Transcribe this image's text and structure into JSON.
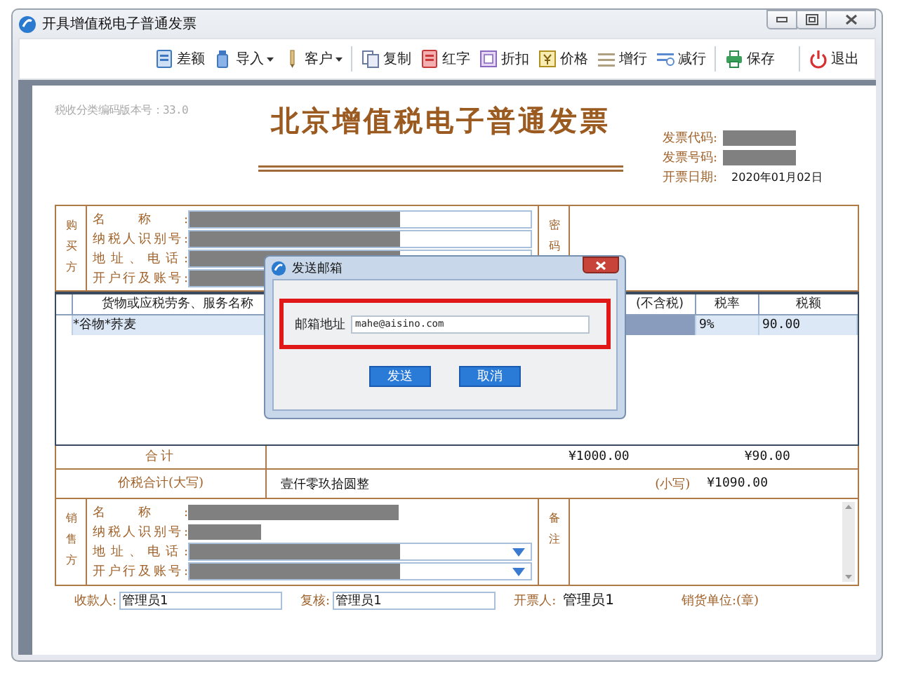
{
  "window": {
    "title": "开具增值税电子普通发票"
  },
  "toolbar": [
    [
      {
        "label": "差额",
        "has_menu": false
      },
      {
        "label": "导入",
        "has_menu": true
      },
      {
        "label": "客户",
        "has_menu": true
      }
    ],
    [
      {
        "label": "复制",
        "has_menu": false
      },
      {
        "label": "红字",
        "has_menu": false
      },
      {
        "label": "折扣",
        "has_menu": false
      },
      {
        "label": "价格",
        "has_menu": false
      },
      {
        "label": "增行",
        "has_menu": false
      },
      {
        "label": "减行",
        "has_menu": false
      }
    ],
    [
      {
        "label": "保存",
        "has_menu": false
      }
    ],
    [
      {
        "label": "退出",
        "has_menu": false
      }
    ]
  ],
  "invoice": {
    "version_note": "税收分类编码版本号：33.0",
    "title": "北京增值税电子普通发票",
    "info": [
      {
        "label": "发票代码:",
        "redacted": true
      },
      {
        "label": "发票号码:",
        "redacted": true
      },
      {
        "label": "开票日期:",
        "value": "2020年01月02日"
      }
    ],
    "buyer": {
      "heading": "购买方",
      "fields": [
        {
          "label": "名称:"
        },
        {
          "label": "纳税人识别号:"
        },
        {
          "label": "地址、电话:"
        },
        {
          "label": "开户行及账号:"
        }
      ],
      "side_heading": "密码"
    },
    "items": {
      "columns": [
        "货物或应税劳务、服务名称",
        "(不含税)",
        "税率",
        "税额"
      ],
      "rows": [
        {
          "name": "*谷物*荞麦",
          "rate": "9%",
          "tax": "90.00",
          "selected": true
        }
      ]
    },
    "total": {
      "label": "合计",
      "amount": "¥1000.00",
      "tax": "¥90.00"
    },
    "grand_total": {
      "label": "价税合计(大写)",
      "words": "壹仟零玖拾圆整",
      "small_label": "(小写)",
      "small_value": "¥1090.00"
    },
    "seller": {
      "heading": "销售方",
      "fields": [
        {
          "label": "名称:",
          "kind": "text"
        },
        {
          "label": "纳税人识别号:",
          "kind": "text"
        },
        {
          "label": "地址、电话:",
          "kind": "dropdown"
        },
        {
          "label": "开户行及账号:",
          "kind": "dropdown"
        }
      ],
      "side_heading": "备注"
    },
    "footer": {
      "payee": {
        "label": "收款人:",
        "value": "管理员1"
      },
      "reviewer": {
        "label": "复核:",
        "value": "管理员1"
      },
      "drawer": {
        "label": "开票人:",
        "value": "管理员1"
      },
      "seal": "销货单位:(章)"
    }
  },
  "dialog": {
    "title": "发送邮箱",
    "field_label": "邮箱地址",
    "email": "mahe@aisino.com",
    "buttons": [
      "发送",
      "取消"
    ]
  }
}
